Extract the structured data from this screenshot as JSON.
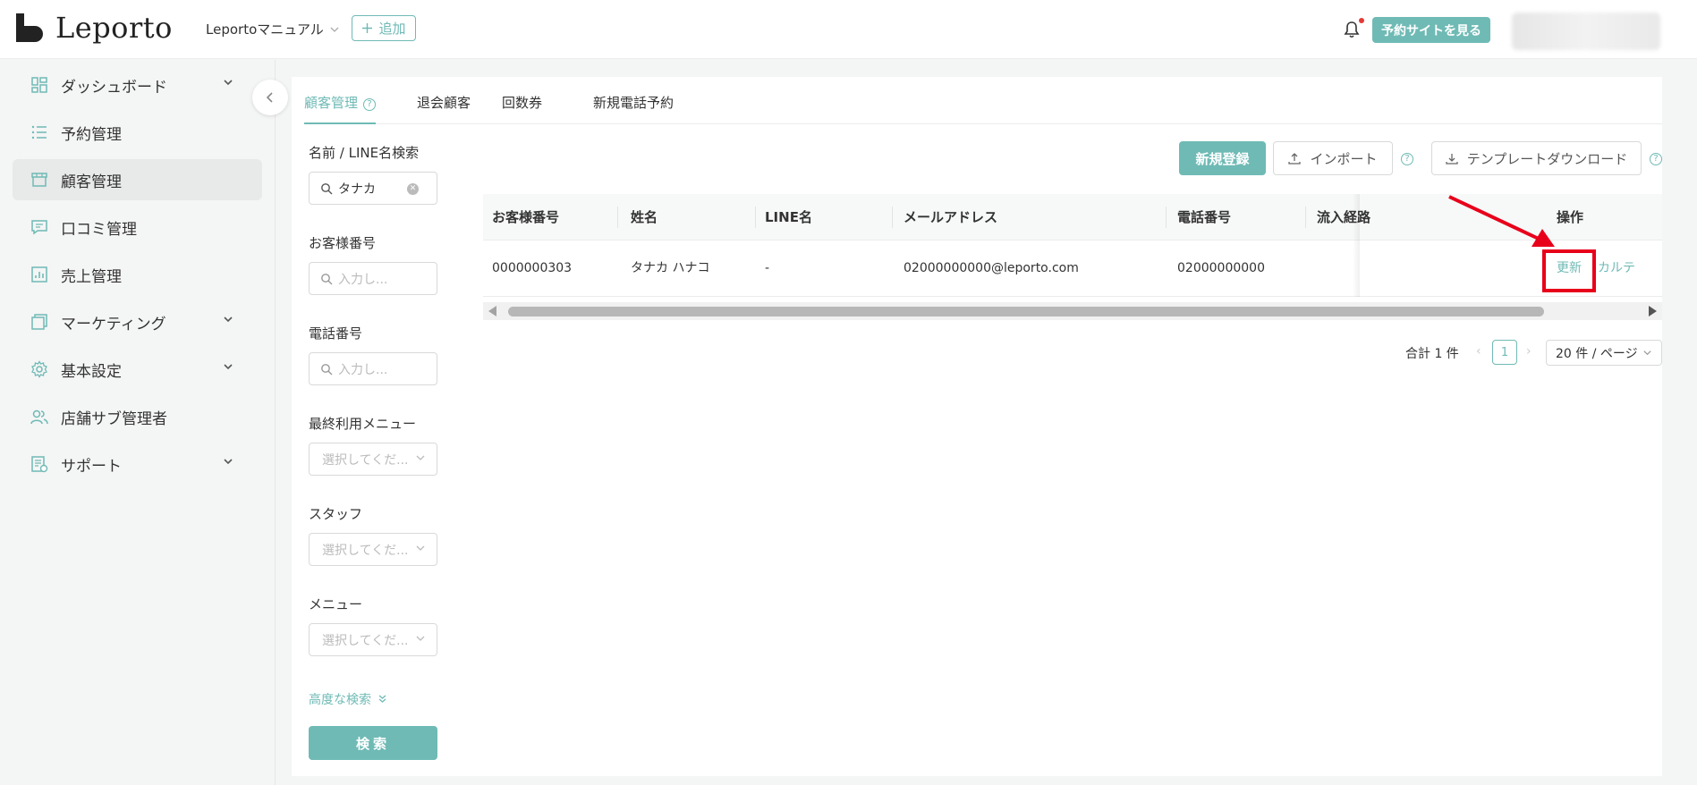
{
  "header": {
    "logo_text": "Leporto",
    "shop_name": "Leportoマニュアル",
    "add_label": "追加",
    "view_site_label": "予約サイトを見る"
  },
  "sidebar": {
    "items": [
      {
        "label": "ダッシュボード",
        "icon": "dashboard-icon",
        "expandable": true
      },
      {
        "label": "予約管理",
        "icon": "list-icon",
        "expandable": false
      },
      {
        "label": "顧客管理",
        "icon": "store-icon",
        "expandable": false,
        "active": true
      },
      {
        "label": "口コミ管理",
        "icon": "comment-icon",
        "expandable": false
      },
      {
        "label": "売上管理",
        "icon": "sales-chart-icon",
        "expandable": false
      },
      {
        "label": "マーケティング",
        "icon": "marketing-icon",
        "expandable": true
      },
      {
        "label": "基本設定",
        "icon": "gear-icon",
        "expandable": true
      },
      {
        "label": "店舗サブ管理者",
        "icon": "users-icon",
        "expandable": false
      },
      {
        "label": "サポート",
        "icon": "support-icon",
        "expandable": true
      }
    ]
  },
  "tabs": [
    {
      "label": "顧客管理",
      "active": true
    },
    {
      "label": "退会顧客"
    },
    {
      "label": "回数券"
    },
    {
      "label": "新規電話予約"
    }
  ],
  "filters": {
    "name_label": "名前 / LINE名検索",
    "name_value": "タナカ",
    "customer_no_label": "お客様番号",
    "customer_no_placeholder": "入力し...",
    "phone_label": "電話番号",
    "phone_placeholder": "入力し...",
    "last_menu_label": "最終利用メニュー",
    "last_menu_placeholder": "選択してくだ...",
    "staff_label": "スタッフ",
    "staff_placeholder": "選択してくだ...",
    "menu_label": "メニュー",
    "menu_placeholder": "選択してくだ...",
    "advanced_label": "高度な検索",
    "search_label": "検索"
  },
  "toolbar": {
    "new_label": "新規登録",
    "import_label": "インポート",
    "template_label": "テンプレートダウンロード"
  },
  "table": {
    "columns": [
      "お客様番号",
      "姓名",
      "LINE名",
      "メールアドレス",
      "電話番号",
      "流入経路",
      "操作"
    ],
    "rows": [
      {
        "customer_no": "0000000303",
        "name": "タナカ ハナコ",
        "line_name": "-",
        "email": "02000000000@leporto.com",
        "phone": "02000000000",
        "source": "",
        "update_label": "更新",
        "karte_label": "カルテ"
      }
    ]
  },
  "pagination": {
    "total": "合計 1 件",
    "current_page": "1",
    "page_size": "20 件 / ページ"
  },
  "colors": {
    "accent": "#6fbab5",
    "highlight": "#e8001b",
    "notification_dot": "#e53935"
  }
}
